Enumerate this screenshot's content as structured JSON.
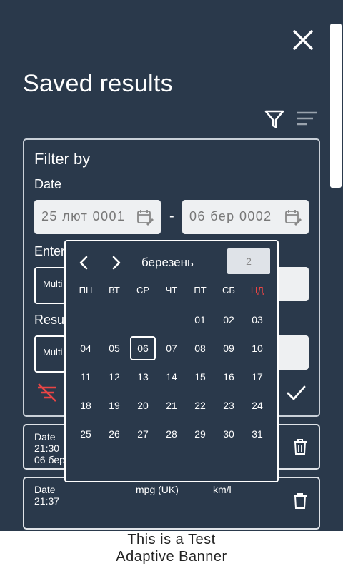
{
  "header": {
    "title": "Saved results"
  },
  "filter": {
    "title": "Filter by",
    "date_label": "Date",
    "date_from": "25 лют 0001",
    "date_to": "06 бер 0002",
    "separator": "-",
    "label2": "Enter",
    "label3": "Resu",
    "select1": "Multi",
    "select2": "Multi"
  },
  "cards": [
    {
      "col1_label": "Date",
      "col1_time": "21:30",
      "col1_date": "06 бер"
    },
    {
      "col1_label": "Date",
      "col2_label": "mpg (UK)",
      "col3_label": "km/l",
      "col1_time": "21:37"
    }
  ],
  "calendar": {
    "month": "березень",
    "year": "2",
    "weekdays": [
      "ПН",
      "ВТ",
      "СР",
      "ЧТ",
      "ПТ",
      "СБ",
      "НД"
    ],
    "weeks": [
      [
        "",
        "",
        "",
        "",
        "01",
        "02",
        "03"
      ],
      [
        "04",
        "05",
        "06",
        "07",
        "08",
        "09",
        "10"
      ],
      [
        "11",
        "12",
        "13",
        "14",
        "15",
        "16",
        "17"
      ],
      [
        "18",
        "19",
        "20",
        "21",
        "22",
        "23",
        "24"
      ],
      [
        "25",
        "26",
        "27",
        "28",
        "29",
        "30",
        "31"
      ]
    ],
    "selected_day": "06",
    "weekend_color": "#e84545"
  },
  "banner": {
    "line1": "This is a Test",
    "line2": "Adaptive Banner"
  },
  "colors": {
    "background": "#2a394b",
    "accent_red": "#e84545"
  }
}
